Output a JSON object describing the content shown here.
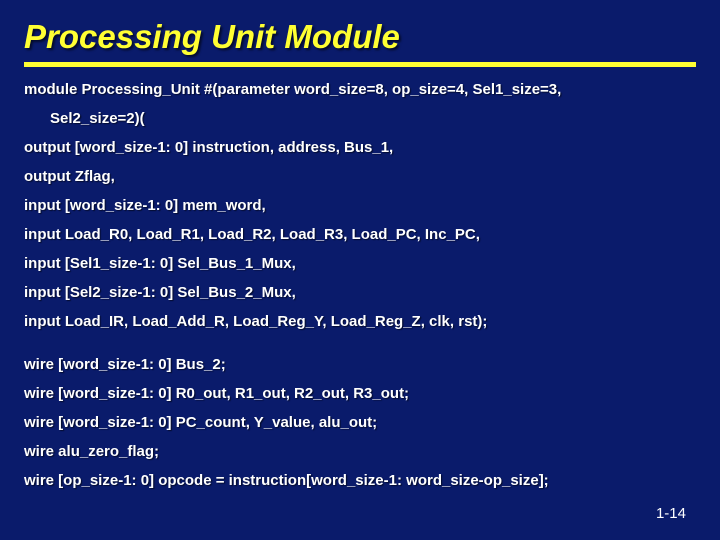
{
  "title": "Processing Unit Module",
  "lines": {
    "l1a": "module Processing_Unit  #(parameter word_size=8, op_size=4, Sel1_size=3,",
    "l1b": "Sel2_size=2)(",
    "l2": "output [word_size-1: 0] instruction, address, Bus_1,",
    "l3": "output Zflag,",
    "l4": "input [word_size-1: 0]  mem_word,",
    "l5": "input Load_R0, Load_R1, Load_R2, Load_R3, Load_PC, Inc_PC,",
    "l6": "input [Sel1_size-1: 0]  Sel_Bus_1_Mux,",
    "l7": "input [Sel2_size-1: 0]  Sel_Bus_2_Mux,",
    "l8": "input Load_IR, Load_Add_R, Load_Reg_Y, Load_Reg_Z, clk, rst);",
    "w1": "wire  [word_size-1: 0] Bus_2;",
    "w2": "wire  [word_size-1: 0] R0_out, R1_out, R2_out, R3_out;",
    "w3": "wire  [word_size-1: 0] PC_count, Y_value, alu_out;",
    "w4": "wire alu_zero_flag;",
    "w5": "wire  [op_size-1: 0]  opcode = instruction[word_size-1: word_size-op_size];"
  },
  "page": "1-14"
}
